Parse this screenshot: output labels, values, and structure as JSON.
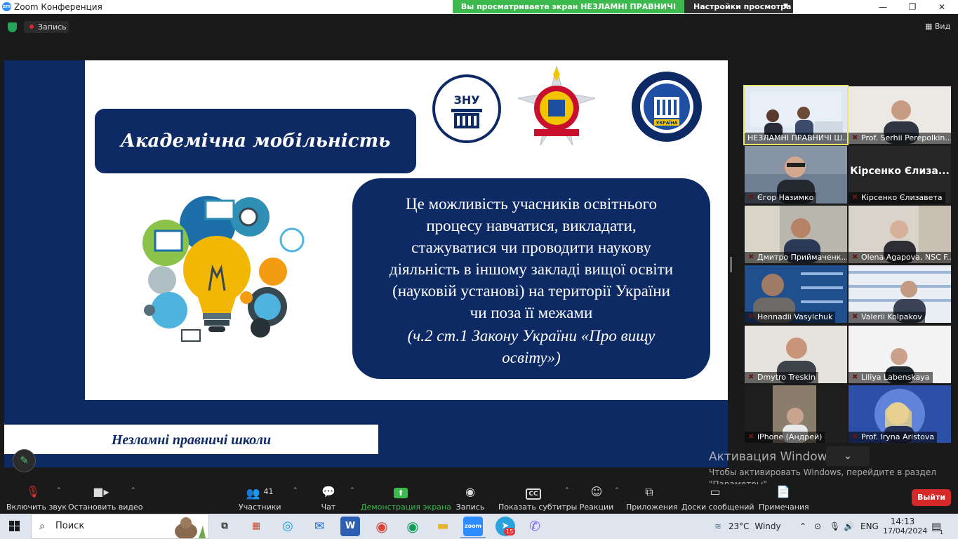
{
  "window": {
    "app_title": "Zoom Конференция",
    "zoom_logo_text": "zm",
    "share_banner": "Вы просматриваете экран НЕЗЛАМНІ ПРАВНИЧІ ШКОЛИ",
    "view_options": "Настройки просмотра",
    "minimize": "—",
    "restore": "❐",
    "close": "✕"
  },
  "topbar": {
    "recording": "Запись",
    "view": "Вид"
  },
  "slide": {
    "title": "Академічна мобільність",
    "definition_lines": [
      "Це можливість учасників освітнього",
      "процесу навчатися, викладати,",
      "стажуватися чи проводити наукову",
      "діяльність в іншому закладі вищої освіти",
      "(науковій установі) на території України",
      "чи поза її межами"
    ],
    "citation_lines": [
      "(ч.2 ст.1 Закону України «Про вищу",
      "освіту»)"
    ],
    "footer": "Незламні правничі школи",
    "logo1_text": "ЗНУ",
    "logo3_text": "УКРАЇНА"
  },
  "participants": [
    {
      "name": "НЕЗЛАМНІ ПРАВНИЧІ Ш...",
      "muted": false,
      "active": true
    },
    {
      "name": "Prof. Serhii Perepolkin...",
      "muted": true
    },
    {
      "name": "Єгор Назимко",
      "muted": true
    },
    {
      "name": "Кірсенко Єлизавета",
      "muted": true,
      "big_label": "Кірсенко Єлиза..."
    },
    {
      "name": "Дмитро Приймаченк...",
      "muted": true
    },
    {
      "name": "Olena Agapova, NSC F...",
      "muted": true
    },
    {
      "name": "Hennadii Vasylchuk",
      "muted": true
    },
    {
      "name": "Valerii Kolpakov",
      "muted": true
    },
    {
      "name": "Dmytro Treskin",
      "muted": true
    },
    {
      "name": "Liliya Labenskaya",
      "muted": true
    },
    {
      "name": "iPhone (Андрей)",
      "muted": true
    },
    {
      "name": "Prof. Iryna Aristova",
      "muted": true
    }
  ],
  "activation": {
    "title": "Активация Windows",
    "line1": "Чтобы активировать Windows, перейдите в раздел",
    "line2": "\"Параметры\"."
  },
  "toolbar": {
    "unmute": "Включить звук",
    "stop_video": "Остановить видео",
    "participants": "Участники",
    "participants_count": "41",
    "chat": "Чат",
    "share_screen": "Демонстрация экрана",
    "record": "Запись",
    "captions": "Показать субтитры",
    "reactions": "Реакции",
    "apps": "Приложения",
    "whiteboards": "Доски сообщений",
    "notes": "Примечания",
    "leave": "Выйти"
  },
  "taskbar": {
    "search": "Поиск",
    "weather_temp": "23°C",
    "weather_text": "Windy",
    "lang": "ENG",
    "time": "14:13",
    "date": "17/04/2024",
    "telegram_badge": "15",
    "notif_count": "1"
  },
  "colors": {
    "accent_green": "#3dba4e",
    "slide_navy": "#0d2a64",
    "leave_red": "#d42a2a",
    "zoom_blue": "#2d8cff"
  }
}
